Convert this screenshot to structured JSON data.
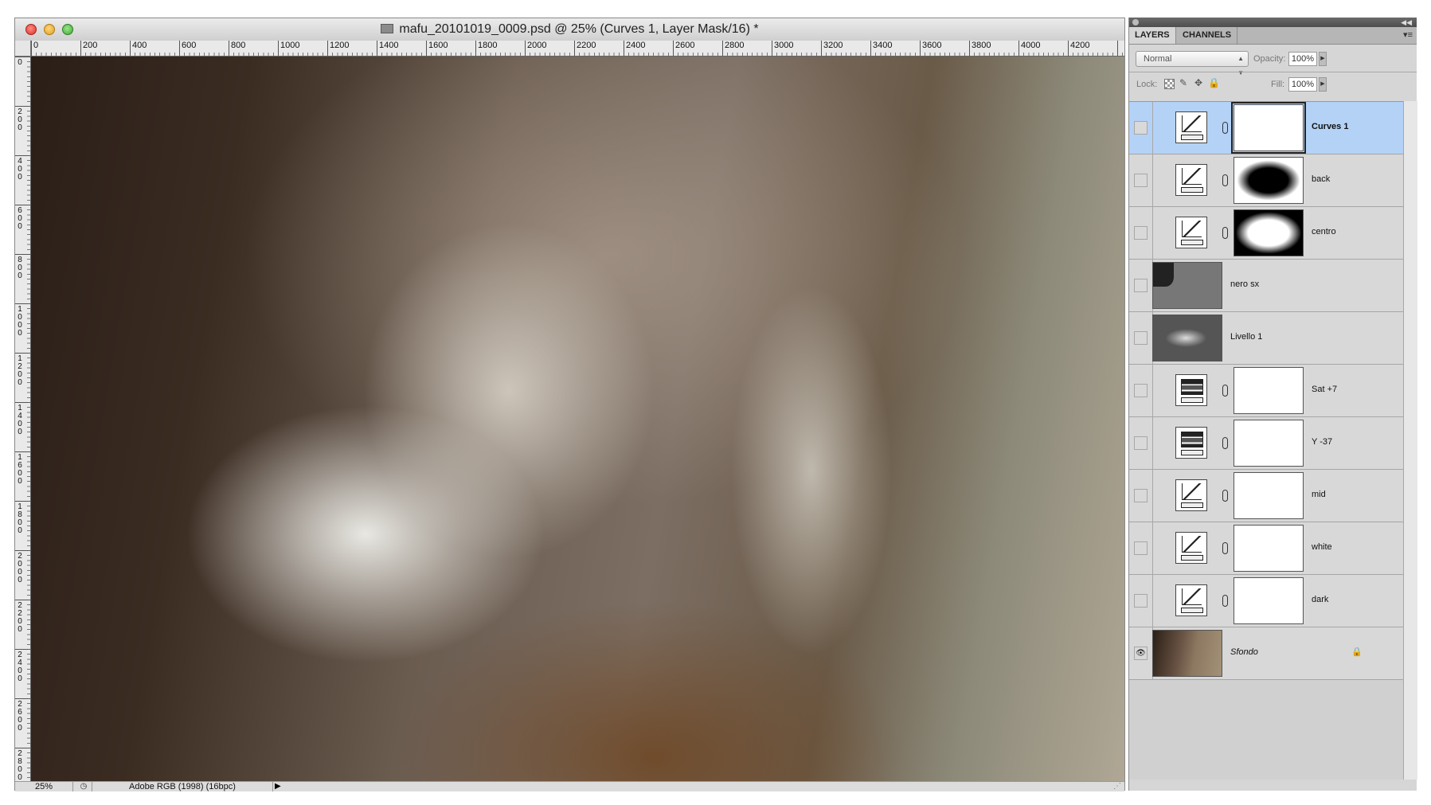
{
  "document": {
    "title": "mafu_20101019_0009.psd @ 25% (Curves 1, Layer Mask/16) *",
    "ruler_top_labels": [
      "0",
      "200",
      "400",
      "600",
      "800",
      "1000",
      "1200",
      "1400",
      "1600",
      "1800",
      "2000",
      "2200",
      "2400",
      "2600",
      "2800",
      "3000",
      "3200",
      "3400",
      "3600",
      "3800",
      "4000",
      "4200"
    ],
    "ruler_left_labels": [
      "0",
      "200",
      "400",
      "600",
      "800",
      "1000",
      "1200",
      "1400",
      "1600",
      "1800",
      "2000",
      "2200",
      "2400",
      "2600",
      "2800"
    ],
    "status": {
      "zoom": "25%",
      "profile": "Adobe RGB (1998) (16bpc)"
    }
  },
  "layers_panel": {
    "tabs": [
      "LAYERS",
      "CHANNELS"
    ],
    "blend_mode": "Normal",
    "opacity_label": "Opacity:",
    "opacity_value": "100%",
    "lock_label": "Lock:",
    "fill_label": "Fill:",
    "fill_value": "100%",
    "layers": [
      {
        "name": "Curves 1",
        "kind": "curves",
        "mask": "white",
        "selected": true,
        "visible": false
      },
      {
        "name": "back",
        "kind": "curves",
        "mask": "back",
        "selected": false,
        "visible": false
      },
      {
        "name": "centro",
        "kind": "curves",
        "mask": "centro",
        "selected": false,
        "visible": false
      },
      {
        "name": "nero sx",
        "kind": "pixel",
        "thumb": "nero",
        "selected": false,
        "visible": false
      },
      {
        "name": "Livello 1",
        "kind": "pixel",
        "thumb": "livello",
        "selected": false,
        "visible": false
      },
      {
        "name": "Sat +7",
        "kind": "hue",
        "mask": "white",
        "selected": false,
        "visible": false
      },
      {
        "name": "Y -37",
        "kind": "hue",
        "mask": "white",
        "selected": false,
        "visible": false
      },
      {
        "name": "mid",
        "kind": "curves",
        "mask": "white",
        "selected": false,
        "visible": false
      },
      {
        "name": "white",
        "kind": "curves",
        "mask": "white",
        "selected": false,
        "visible": false
      },
      {
        "name": "dark",
        "kind": "curves",
        "mask": "white",
        "selected": false,
        "visible": false
      },
      {
        "name": "Sfondo",
        "kind": "background",
        "thumb": "sfondo",
        "selected": false,
        "visible": true,
        "locked": true
      }
    ]
  },
  "colors": {
    "selection_highlight": "#b4d2f6",
    "panel_background": "#d6d6d6"
  }
}
